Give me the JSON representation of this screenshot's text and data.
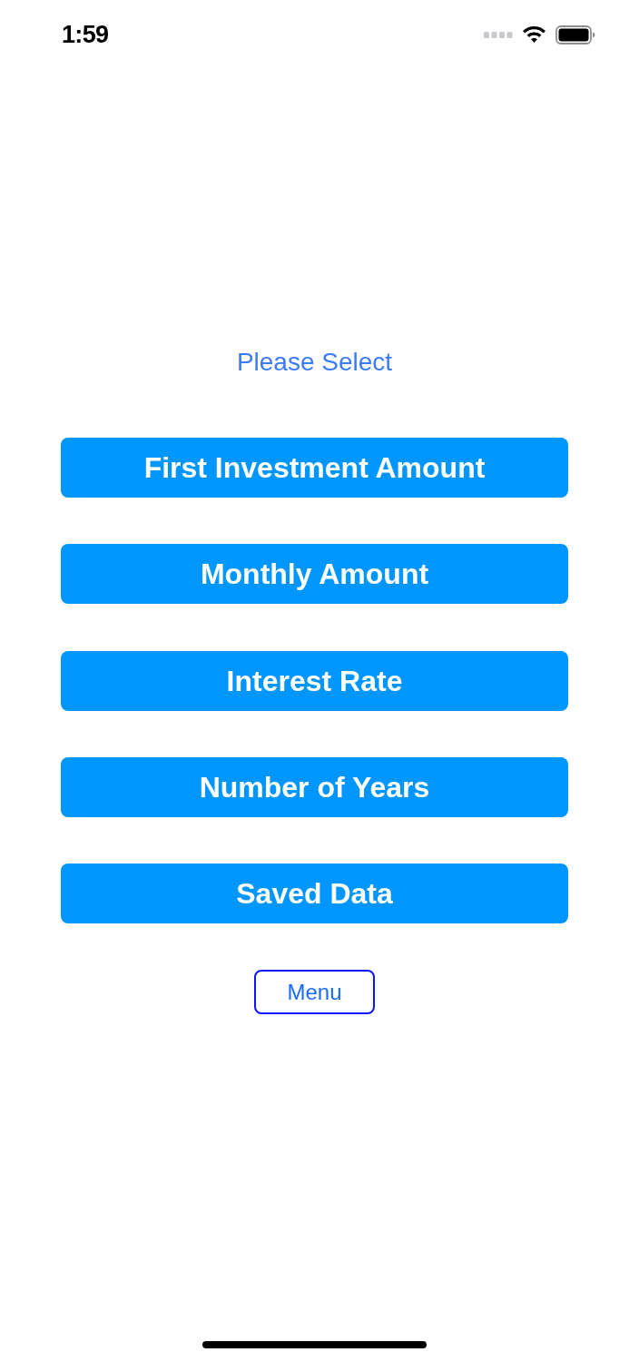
{
  "status_bar": {
    "time": "1:59"
  },
  "prompt": "Please Select",
  "buttons": [
    {
      "label": "First Investment Amount"
    },
    {
      "label": "Monthly Amount"
    },
    {
      "label": "Interest Rate"
    },
    {
      "label": "Number of Years"
    },
    {
      "label": "Saved Data"
    }
  ],
  "menu_button": {
    "label": "Menu"
  }
}
